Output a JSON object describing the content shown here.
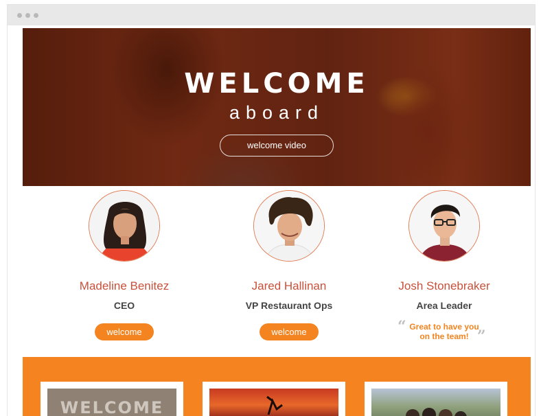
{
  "hero": {
    "title": "WELCOME",
    "subtitle": "aboard",
    "video_button": "welcome video"
  },
  "people": [
    {
      "name": "Madeline Benitez",
      "role": "CEO",
      "action": "welcome"
    },
    {
      "name": "Jared Hallinan",
      "role": "VP Restaurant Ops",
      "action": "welcome"
    },
    {
      "name": "Josh Stonebraker",
      "role": "Area Leader",
      "quote_line1": "Great to have you",
      "quote_line2": "on the team!"
    }
  ],
  "cards": [
    {
      "image_text": "WELCOME"
    },
    {
      "image_text": ""
    },
    {
      "image_text": ""
    }
  ],
  "colors": {
    "accent": "#f5831f",
    "name": "#c8503a",
    "hero": "#6e2a14"
  }
}
